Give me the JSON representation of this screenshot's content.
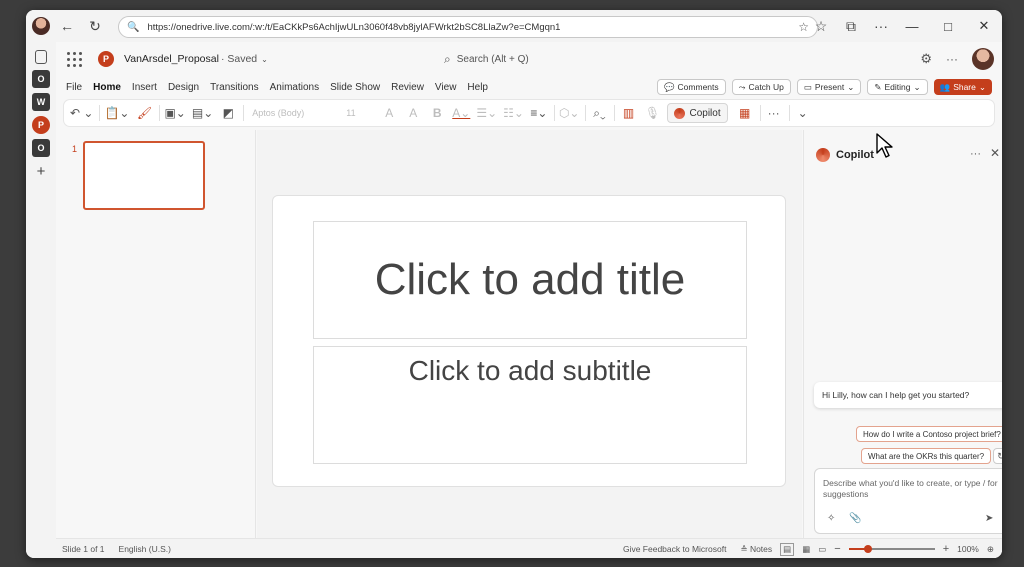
{
  "browser": {
    "url": "https://onedrive.live.com/:w:/t/EaCKkPs6AchIjwULn3060f48vb8jylAFWrkt2bSC8LlaZw?e=CMgqn1"
  },
  "app": {
    "doc_title": "VanArsdel_Proposal",
    "doc_status": "· Saved",
    "search_placeholder": "Search (Alt + Q)"
  },
  "menu": {
    "tabs": [
      "File",
      "Home",
      "Insert",
      "Design",
      "Transitions",
      "Animations",
      "Slide Show",
      "Review",
      "View",
      "Help"
    ],
    "active": "Home",
    "comments": "Comments",
    "catch_up": "Catch Up",
    "present": "Present",
    "editing": "Editing",
    "share": "Share"
  },
  "ribbon": {
    "font_name": "Aptos (Body)",
    "font_size": "11",
    "copilot_label": "Copilot"
  },
  "slides": {
    "thumb_number": "1",
    "title_placeholder": "Click to add title",
    "subtitle_placeholder": "Click to add subtitle"
  },
  "copilot": {
    "title": "Copilot",
    "greeting": "Hi Lilly, how can I help get you started?",
    "suggestions": [
      "How do I write a Contoso project brief?",
      "What are the OKRs this quarter?"
    ],
    "compose_placeholder": "Describe what you'd like to create, or type / for suggestions"
  },
  "status": {
    "slide_counter": "Slide 1 of 1",
    "language": "English (U.S.)",
    "feedback": "Give Feedback to Microsoft",
    "notes": "Notes",
    "zoom": "100%",
    "zoom_level": 0.22
  },
  "colors": {
    "accent": "#c43e1c"
  }
}
